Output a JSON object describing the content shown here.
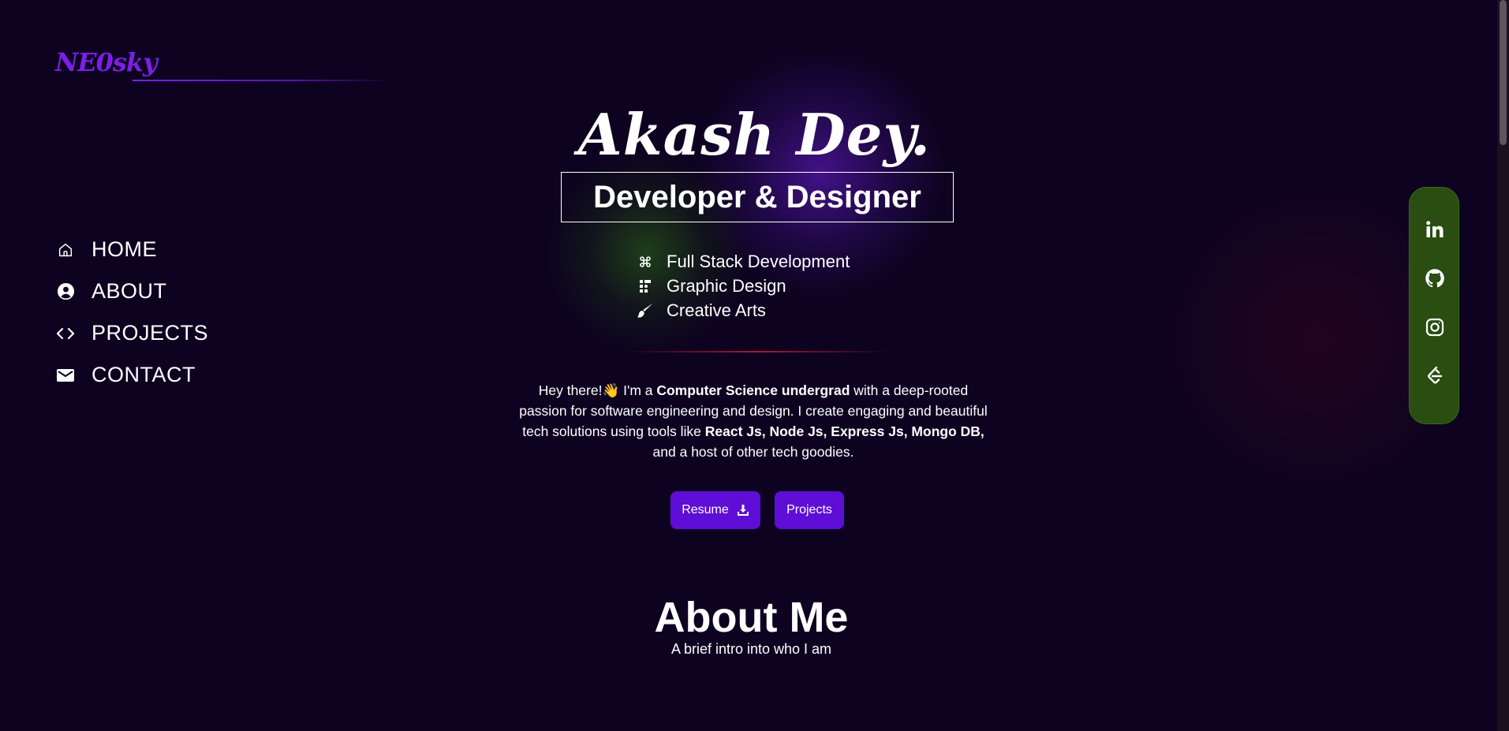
{
  "logo": {
    "text": "NE0sky"
  },
  "nav": {
    "items": [
      {
        "label": "HOME",
        "icon": "home-icon"
      },
      {
        "label": "ABOUT",
        "icon": "user-circle-icon"
      },
      {
        "label": "PROJECTS",
        "icon": "code-icon"
      },
      {
        "label": "CONTACT",
        "icon": "mail-icon"
      }
    ]
  },
  "hero": {
    "name": "Akash Dey.",
    "role": "Developer & Designer",
    "skills": [
      {
        "label": "Full Stack Development",
        "icon": "command-icon"
      },
      {
        "label": "Graphic Design",
        "icon": "figma-icon"
      },
      {
        "label": "Creative Arts",
        "icon": "brush-icon"
      }
    ],
    "bio": {
      "p1": "Hey there!👋 I'm a ",
      "b1": "Computer Science undergrad",
      "p2": " with a deep-rooted passion for software engineering and design. I create engaging and beautiful tech solutions using tools like ",
      "b2": "React Js, Node Js, Express Js, Mongo DB,",
      "p3": " and a host of other tech goodies."
    },
    "buttons": {
      "resume": "Resume",
      "projects": "Projects"
    }
  },
  "about": {
    "title": "About Me",
    "subtitle": "A brief intro into who I am"
  },
  "social": {
    "items": [
      "linkedin-icon",
      "github-icon",
      "instagram-icon",
      "leetcode-icon"
    ]
  },
  "colors": {
    "background": "#0d0320",
    "accent_purple": "#5e0ed6",
    "logo_purple": "#7c1fe6",
    "social_green": "#2a4d12",
    "divider_red": "#b0162e"
  }
}
